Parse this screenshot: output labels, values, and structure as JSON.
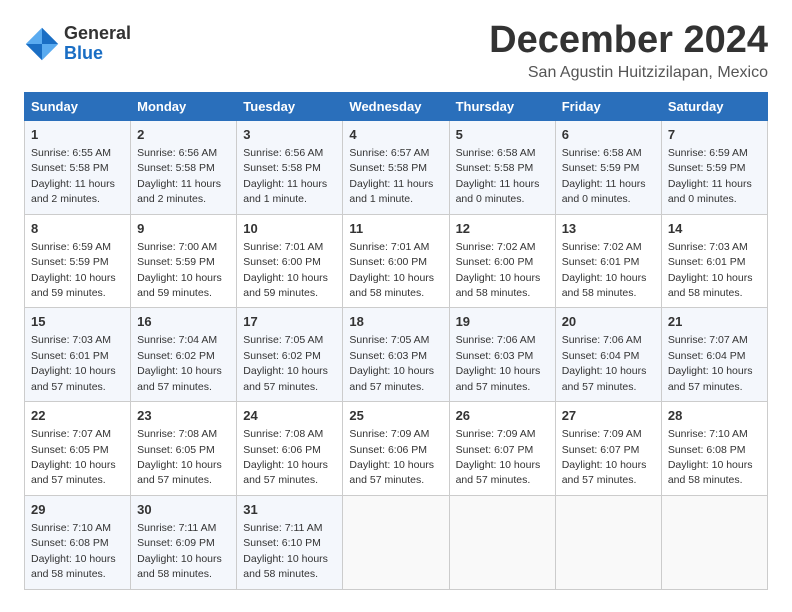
{
  "header": {
    "logo_general": "General",
    "logo_blue": "Blue",
    "month_title": "December 2024",
    "location": "San Agustin Huitzizilapan, Mexico"
  },
  "calendar": {
    "days_of_week": [
      "Sunday",
      "Monday",
      "Tuesday",
      "Wednesday",
      "Thursday",
      "Friday",
      "Saturday"
    ],
    "weeks": [
      [
        null,
        null,
        null,
        null,
        null,
        null,
        null
      ]
    ],
    "cells": [
      {
        "day": null
      },
      {
        "day": null
      },
      {
        "day": null
      },
      {
        "day": null
      },
      {
        "day": null
      },
      {
        "day": null
      },
      {
        "day": null
      }
    ]
  }
}
